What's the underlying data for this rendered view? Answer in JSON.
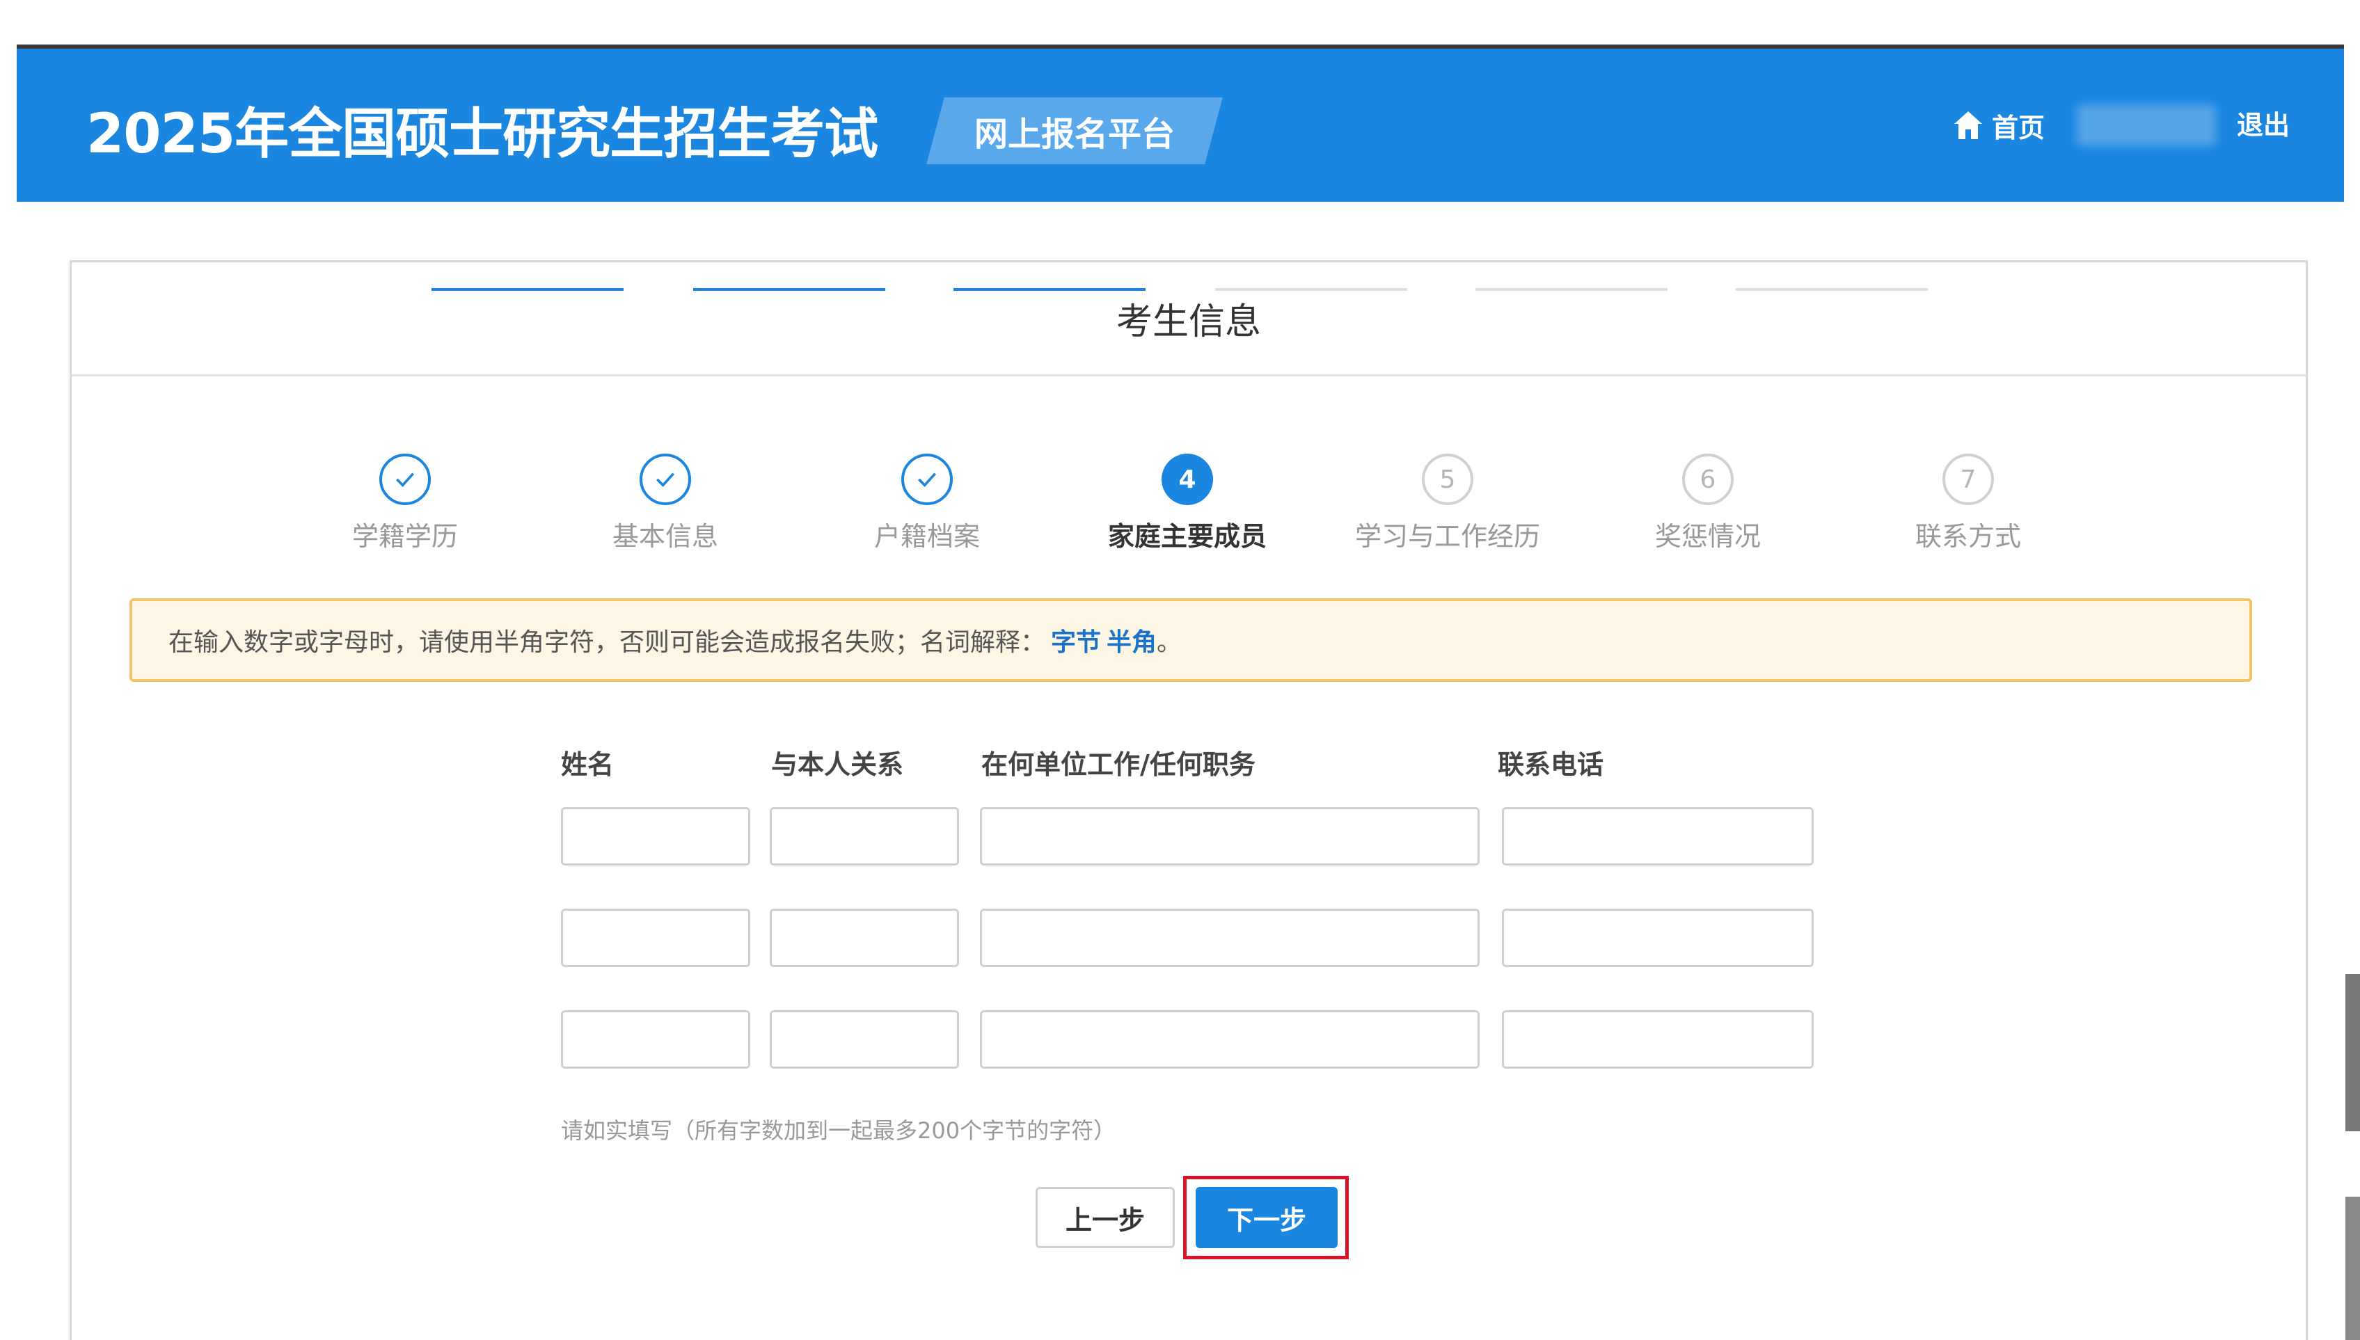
{
  "header": {
    "site_title": "2025年全国硕士研究生招生考试",
    "platform_badge": "网上报名平台",
    "home_label": "首页",
    "logout_label": "退出",
    "colors": {
      "primary": "#1a86e0",
      "badge": "#5aa8ec"
    }
  },
  "panel": {
    "title": "考生信息"
  },
  "steps": [
    {
      "label": "学籍学历",
      "state": "done",
      "number": "1"
    },
    {
      "label": "基本信息",
      "state": "done",
      "number": "2"
    },
    {
      "label": "户籍档案",
      "state": "done",
      "number": "3"
    },
    {
      "label": "家庭主要成员",
      "state": "active",
      "number": "4"
    },
    {
      "label": "学习与工作经历",
      "state": "todo",
      "number": "5"
    },
    {
      "label": "奖惩情况",
      "state": "todo",
      "number": "6"
    },
    {
      "label": "联系方式",
      "state": "todo",
      "number": "7"
    }
  ],
  "notice": {
    "text": "在输入数字或字母时，请使用半角字符，否则可能会造成报名失败；名词解释：",
    "link_byte": "字节",
    "link_halfwidth": "半角",
    "end": "。"
  },
  "table": {
    "columns": [
      "姓名",
      "与本人关系",
      "在何单位工作/任何职务",
      "联系电话"
    ],
    "rows": [
      {
        "name": "",
        "relation": "",
        "work": "",
        "phone": ""
      },
      {
        "name": "",
        "relation": "",
        "work": "",
        "phone": ""
      },
      {
        "name": "",
        "relation": "",
        "work": "",
        "phone": ""
      }
    ]
  },
  "hint": "请如实填写（所有字数加到一起最多200个字节的字符）",
  "buttons": {
    "prev": "上一步",
    "next": "下一步"
  }
}
